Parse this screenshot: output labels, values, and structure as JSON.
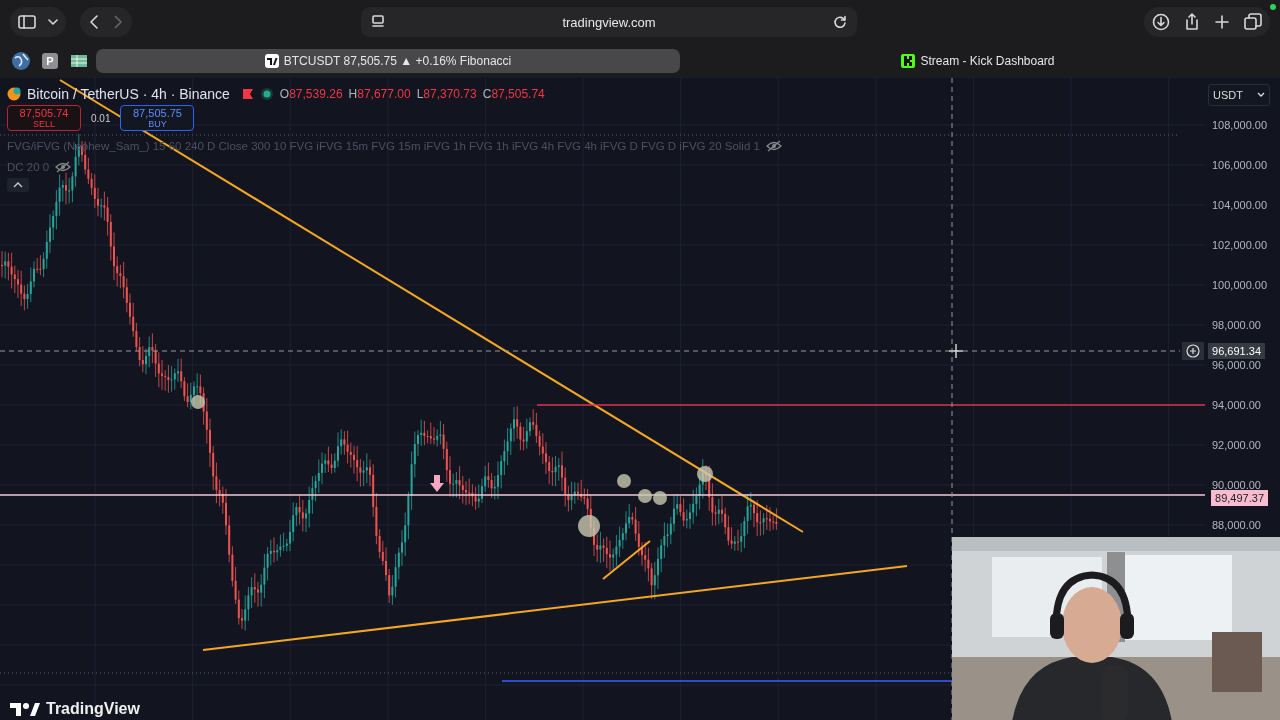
{
  "browser": {
    "address": "tradingview.com",
    "pinned": [
      {
        "kind": "globe"
      },
      {
        "kind": "letter",
        "label": "P"
      },
      {
        "kind": "sheet"
      }
    ],
    "tabs": [
      {
        "title": "BTCUSDT 87,505.75 ▲ +0.16% Fibonacci",
        "selected": true
      },
      {
        "title": "Stream - Kick Dashboard",
        "selected": false
      }
    ]
  },
  "chart": {
    "symbol": "Bitcoin / TetherUS · 4h · Binance",
    "ohlc": [
      {
        "label": "O",
        "value": "87,539.26"
      },
      {
        "label": "H",
        "value": "87,677.00"
      },
      {
        "label": "L",
        "value": "87,370.73"
      },
      {
        "label": "C",
        "value": "87,505.74"
      }
    ],
    "sell": {
      "price": "87,505.74",
      "label": "SELL"
    },
    "quantity": "0.01",
    "buy": {
      "price": "87,505.75",
      "label": "BUY"
    },
    "indicators": [
      {
        "text": "FVG/iFVG (Nephew_Sam_) 15 60 240 D Close 300 10 FVG iFVG 15m FVG 15m iFVG 1h FVG 1h iFVG 4h FVG 4h iFVG D FVG D iFVG 20 Solid 1",
        "hidden": true
      },
      {
        "text": "DC 20 0",
        "hidden": true
      }
    ],
    "currency": "USDT",
    "price_scale": [
      "108,000.00",
      "106,000.00",
      "104,000.00",
      "102,000.00",
      "100,000.00",
      "98,000.00",
      "96,000.00",
      "94,000.00",
      "92,000.00",
      "90,000.00",
      "88,000.00"
    ],
    "crosshair_price": "96,691.34",
    "level_label": "89,497.37",
    "logo": "TradingView"
  }
}
